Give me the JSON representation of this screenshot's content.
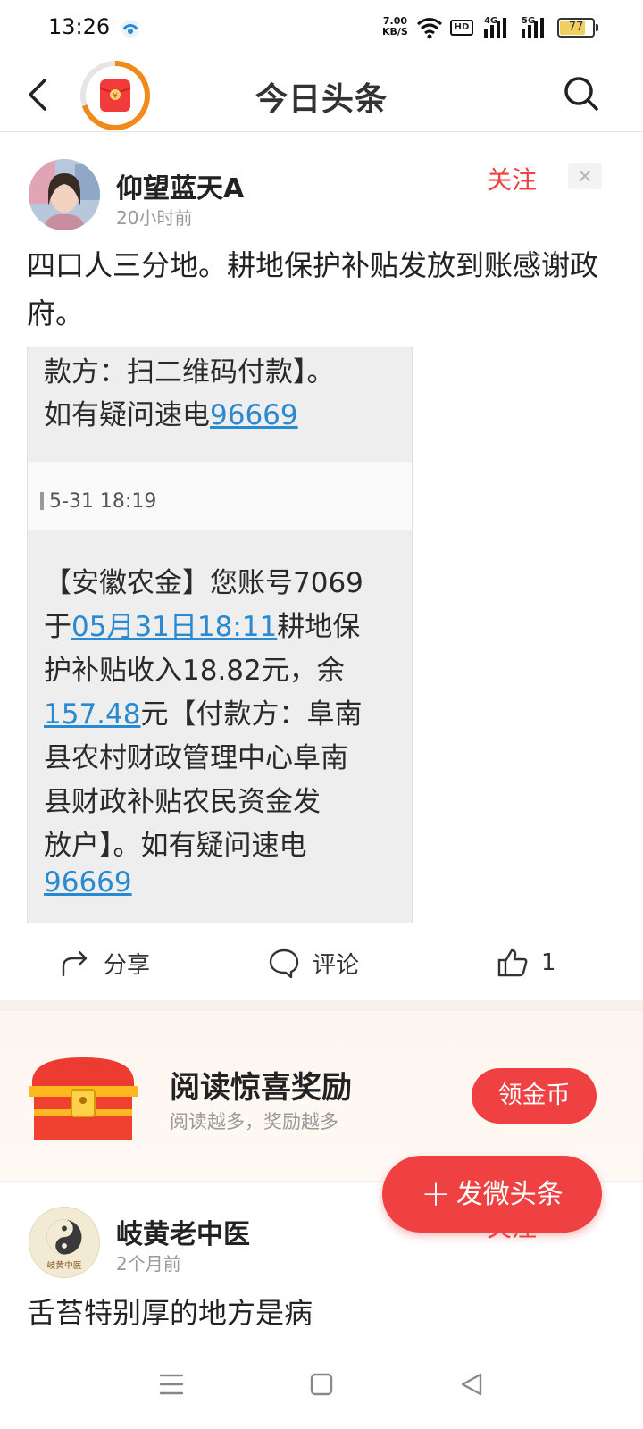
{
  "status_bar": {
    "time": "13:26",
    "speed_value": "7.00",
    "speed_unit": "KB/S",
    "hd_label": "HD",
    "signal1": "4G",
    "signal2": "5G",
    "battery": "77",
    "battery_level": 0.77
  },
  "header": {
    "title": "今日头条",
    "redpacket_symbol": "¥"
  },
  "post": {
    "author": "仰望蓝天A",
    "time": "20小时前",
    "follow_label": "关注",
    "text": "四口人三分地。耕地保护补贴发放到账感谢政府。",
    "sms": {
      "top_line1": "款方：扫二维码付款】。",
      "top_line2_prefix": "如有疑问速电",
      "top_line2_link": "96669",
      "timestamp": "5-31 18:19",
      "line1": "【安徽农金】您账号7069",
      "line2_prefix": "于",
      "line2_link": "05月31日18:11",
      "line2_suffix": "耕地保",
      "line3": "护补贴收入18.82元，余",
      "line4_link": "157.48",
      "line4_suffix": "元【付款方：阜南",
      "line5": "县农村财政管理中心阜南",
      "line6": "县财政补贴农民资金发",
      "line7": "放户】。如有疑问速电",
      "line8_link": "96669"
    },
    "actions": {
      "share": "分享",
      "comment": "评论",
      "like_count": "1"
    }
  },
  "promo": {
    "title": "阅读惊喜奖励",
    "subtitle": "阅读越多，奖励越多",
    "button": "领金币"
  },
  "post2": {
    "author": "岐黄老中医",
    "time": "2个月前",
    "follow_label": "关注",
    "text": "舌苔特别厚的地方是病",
    "avatar_text": "岐黄中医"
  },
  "fab": {
    "plus": "+",
    "label": "发微头条"
  },
  "colors": {
    "accent": "#f04142",
    "link": "#2a8ad0"
  }
}
